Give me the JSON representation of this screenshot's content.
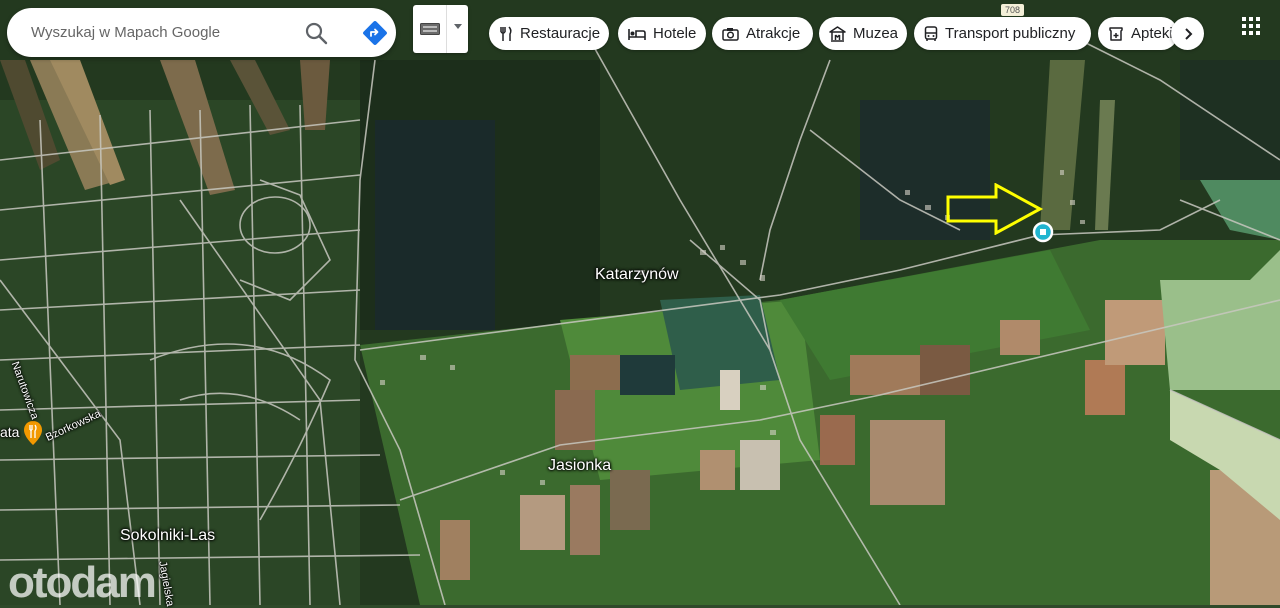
{
  "search": {
    "placeholder": "Wyszukaj w Mapach Google"
  },
  "chips": [
    {
      "label": "Restauracje",
      "icon": "fork-knife-icon"
    },
    {
      "label": "Hotele",
      "icon": "bed-icon"
    },
    {
      "label": "Atrakcje",
      "icon": "camera-icon"
    },
    {
      "label": "Muzea",
      "icon": "museum-icon"
    },
    {
      "label": "Transport publiczny",
      "icon": "bus-icon"
    },
    {
      "label": "Apteki",
      "icon": "pharmacy-icon"
    }
  ],
  "places": {
    "katarzynow": "Katarzynów",
    "jasionka": "Jasionka",
    "sokolniki": "Sokolniki-Las",
    "narutowicza": "Narutowicza",
    "bzorkowska": "Bzorkowska",
    "jagielska": "Jagielska",
    "poi_partial": "ata"
  },
  "road_number": "708",
  "watermark": "otodam",
  "colors": {
    "accent_blue": "#1a73e8",
    "arrow_yellow": "#ffff00",
    "marker_cyan": "#21b5d0",
    "poi_orange": "#f29900"
  }
}
